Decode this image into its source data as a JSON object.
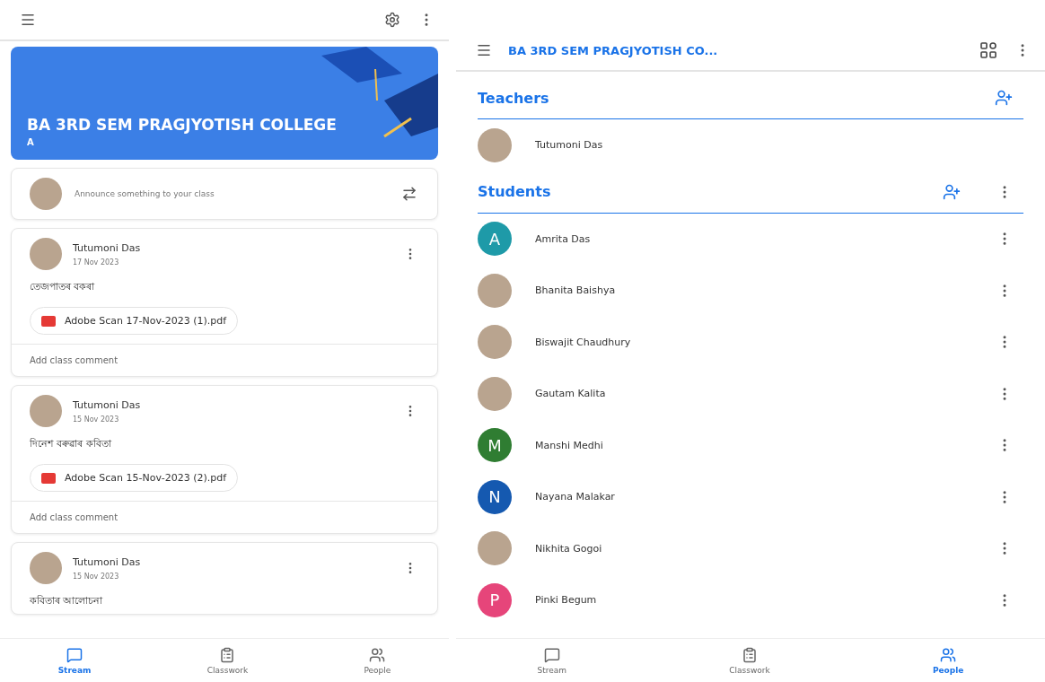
{
  "stream_screen": {
    "banner": {
      "title": "BA 3RD SEM PRAGJYOTISH COLLEGE",
      "section": "A"
    },
    "announce": {
      "placeholder": "Announce something to your class"
    },
    "posts": [
      {
        "author": "Tutumoni Das",
        "date": "17 Nov 2023",
        "text": "তেজপাতৰ বকৰা",
        "attachment": "Adobe Scan 17-Nov-2023 (1).pdf",
        "comment_prompt": "Add class comment"
      },
      {
        "author": "Tutumoni Das",
        "date": "15 Nov 2023",
        "text": "দিনেশ বৰুৱাৰ কবিতা",
        "attachment": "Adobe Scan 15-Nov-2023 (2).pdf",
        "comment_prompt": "Add class comment"
      },
      {
        "author": "Tutumoni Das",
        "date": "15 Nov 2023",
        "text": "কবিতাৰ আলোচনা"
      }
    ],
    "bottom_nav": [
      {
        "label": "Stream",
        "selected": true
      },
      {
        "label": "Classwork",
        "selected": false
      },
      {
        "label": "People",
        "selected": false
      }
    ]
  },
  "people_screen": {
    "top_bar": {
      "title": "BA 3RD SEM PRAGJYOTISH CO..."
    },
    "teachers": {
      "heading": "Teachers",
      "people": [
        {
          "name": "Tutumoni Das",
          "kind": "photo"
        }
      ]
    },
    "students": {
      "heading": "Students",
      "people": [
        {
          "name": "Amrita Das",
          "kind": "letter",
          "initial": "A",
          "color": "#1e9aa8"
        },
        {
          "name": "Bhanita Baishya",
          "kind": "photo"
        },
        {
          "name": "Biswajit Chaudhury",
          "kind": "photo"
        },
        {
          "name": "Gautam Kalita",
          "kind": "photo"
        },
        {
          "name": "Manshi Medhi",
          "kind": "letter",
          "initial": "M",
          "color": "#2f7d32"
        },
        {
          "name": "Nayana Malakar",
          "kind": "letter",
          "initial": "N",
          "color": "#1559b0"
        },
        {
          "name": "Nikhita Gogoi",
          "kind": "photo"
        },
        {
          "name": "Pinki Begum",
          "kind": "letter",
          "initial": "P",
          "color": "#e6457a"
        }
      ]
    },
    "bottom_nav": [
      {
        "label": "Stream",
        "selected": false
      },
      {
        "label": "Classwork",
        "selected": false
      },
      {
        "label": "People",
        "selected": true
      }
    ]
  }
}
